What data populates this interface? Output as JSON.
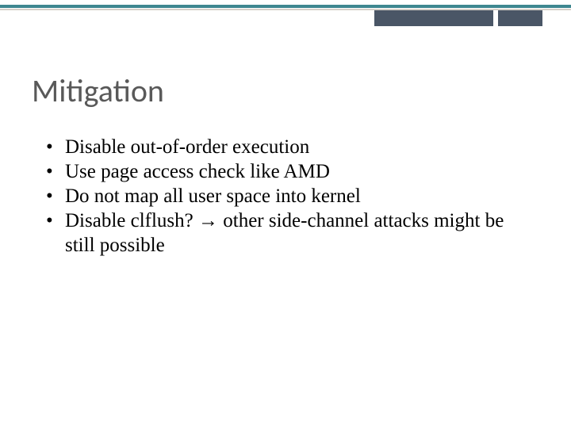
{
  "slide": {
    "title": "Mitigation",
    "bullets": [
      "Disable out-of-order execution",
      "Use page access check like AMD",
      "Do not map all user space into kernel",
      "Disable clflush? → other side-channel attacks might be still possible"
    ]
  }
}
